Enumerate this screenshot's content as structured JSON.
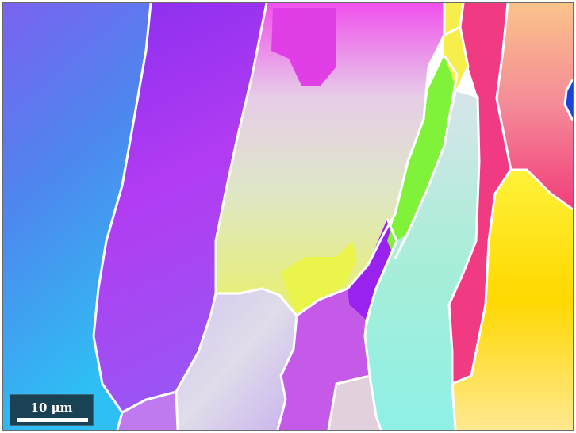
{
  "scalebar": {
    "label": "10 μm"
  },
  "colors": {
    "blue": "#3a7cf0",
    "violet": "#9b3af2",
    "magenta": "#e33ee8",
    "pale_pink": "#e8c8e8",
    "lime": "#e2f06a",
    "green": "#7ef23a",
    "cyan": "#5ee6e0",
    "yellow": "#ffe41a",
    "orange": "#f7a86a",
    "hot_pink": "#f0407f",
    "boundary": "#ffffff"
  }
}
